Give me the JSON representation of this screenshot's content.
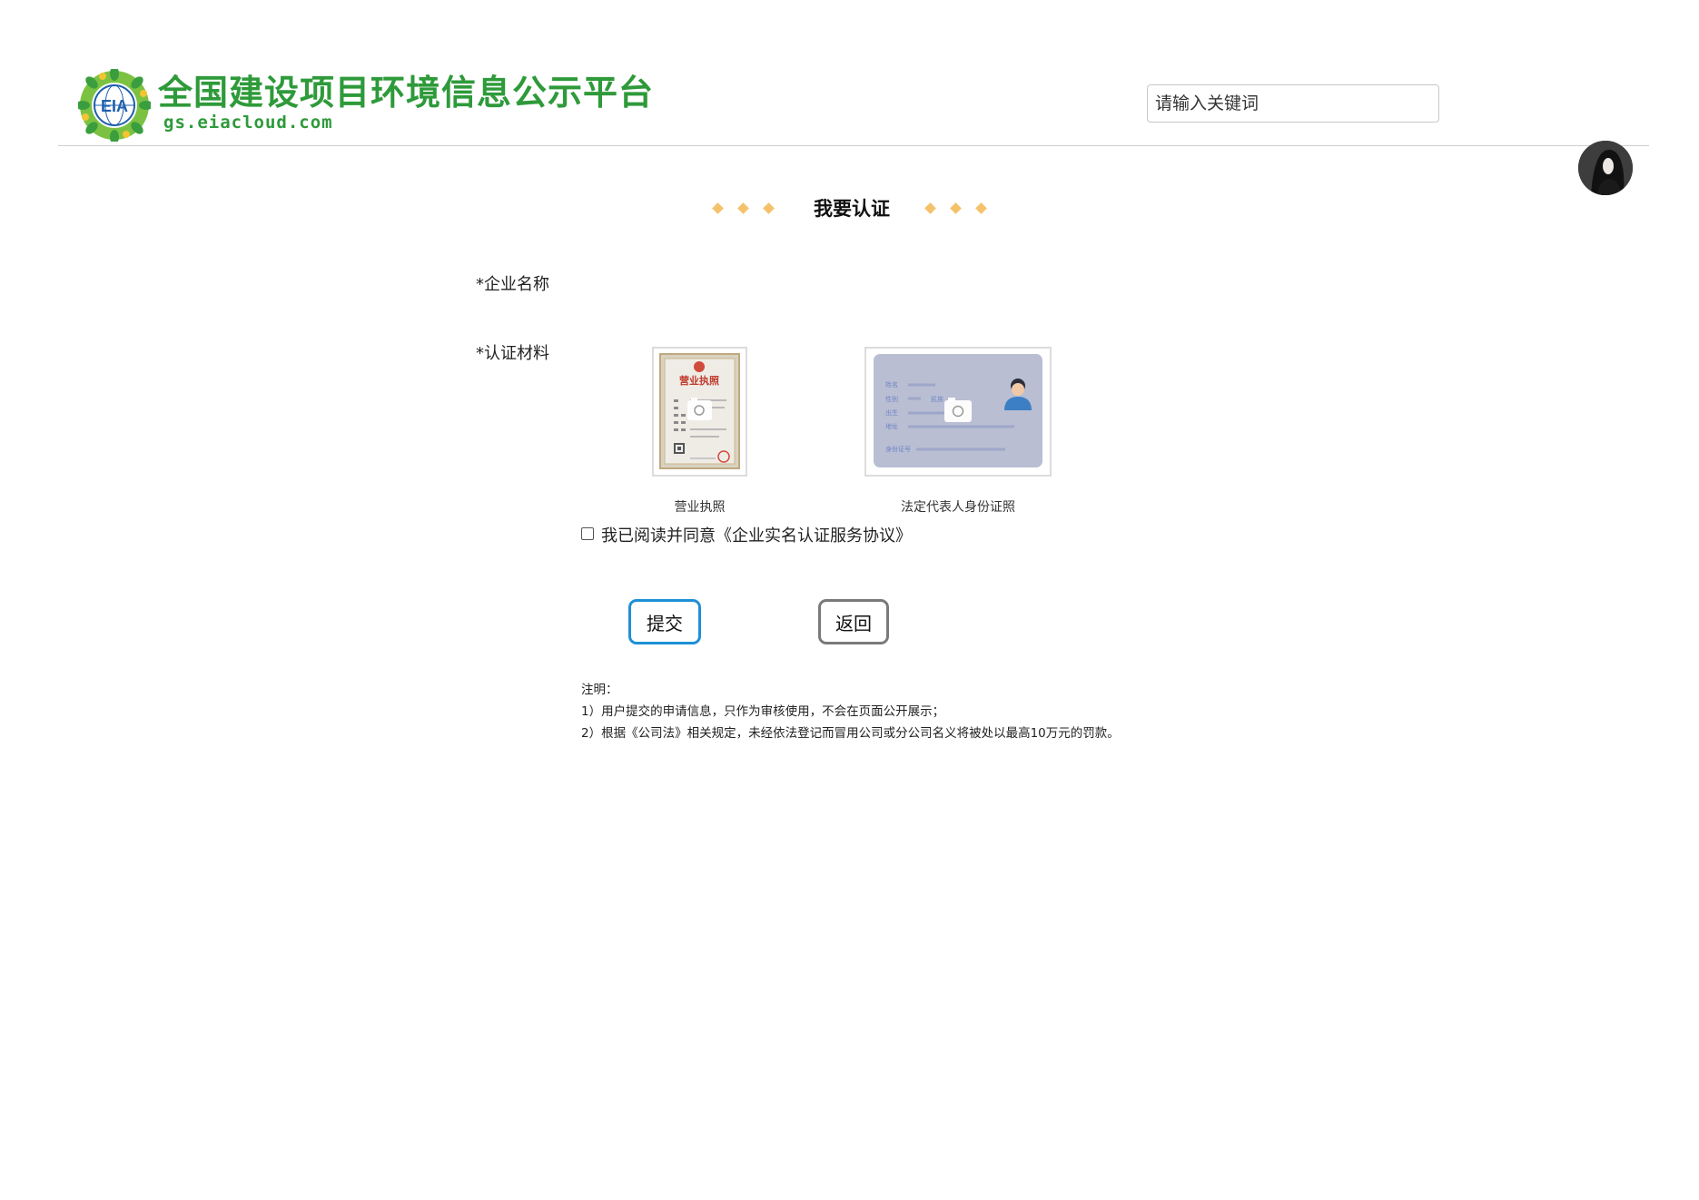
{
  "header": {
    "site_title": "全国建设项目环境信息公示平台",
    "site_domain": "gs.eiacloud.com",
    "logo_text": "EIA",
    "search_placeholder": "请输入关键词"
  },
  "section": {
    "title": "我要认证"
  },
  "form": {
    "company_name_label": "*企业名称",
    "materials_label": "*认证材料",
    "uploads": [
      {
        "caption": "营业执照",
        "icon": "business-license-icon"
      },
      {
        "caption": "法定代表人身份证照",
        "icon": "id-card-icon"
      }
    ],
    "license_card_heading": "营业执照",
    "id_card_fields": [
      "姓名",
      "性别",
      "出生",
      "地址",
      "身份证号"
    ],
    "id_card_ethnicity_label": "民族",
    "agreement_text": "我已阅读并同意《企业实名认证服务协议》",
    "agreement_checked": false
  },
  "buttons": {
    "submit_label": "提交",
    "back_label": "返回"
  },
  "notes": {
    "heading": "注明：",
    "items": [
      "1）用户提交的申请信息，只作为审核使用，不会在页面公开展示；",
      "2）根据《公司法》相关规定，未经依法登记而冒用公司或分公司名义将被处以最高10万元的罚款。"
    ]
  },
  "colors": {
    "brand_green": "#2e9a3a",
    "accent_diamond": "#f5c26b",
    "submit_border": "#1e90d6",
    "back_border": "#7a7a7a"
  }
}
